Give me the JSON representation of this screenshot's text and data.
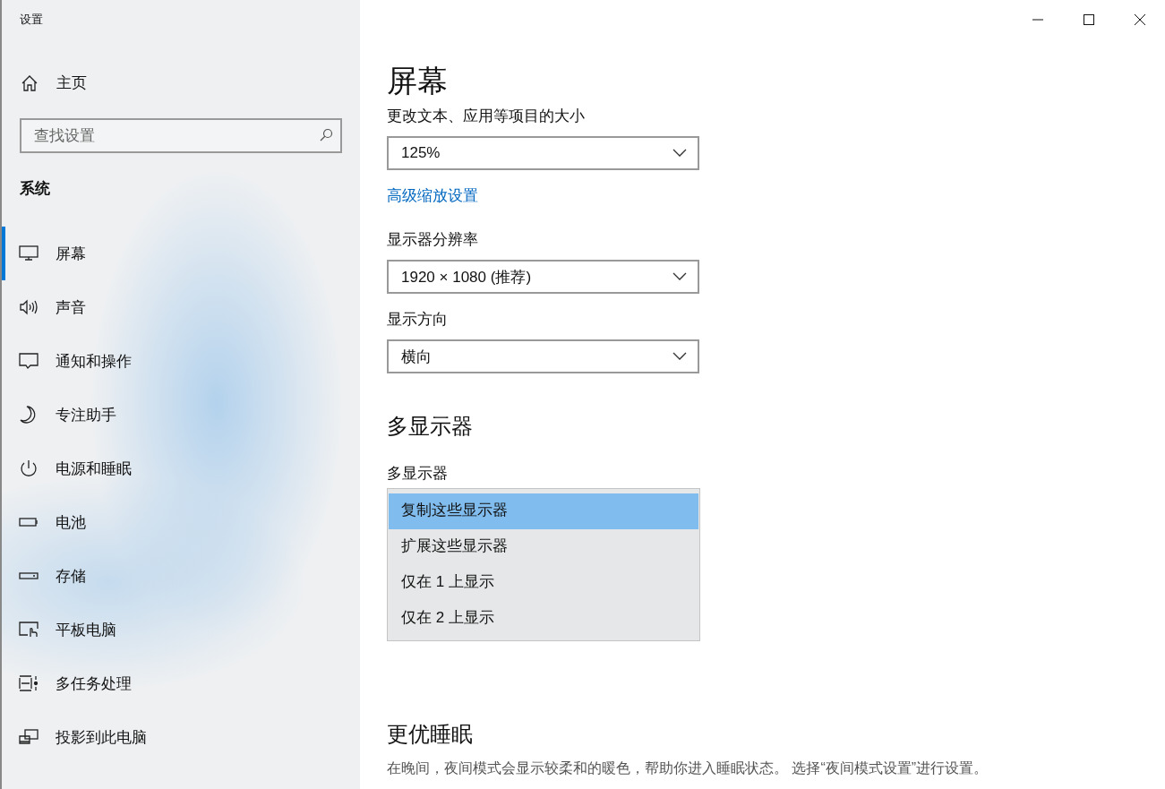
{
  "window": {
    "title": "设置"
  },
  "sidebar": {
    "home": "主页",
    "search": {
      "placeholder": "查找设置"
    },
    "section": "系统",
    "items": [
      {
        "label": "屏幕",
        "selected": true
      },
      {
        "label": "声音",
        "selected": false
      },
      {
        "label": "通知和操作",
        "selected": false
      },
      {
        "label": "专注助手",
        "selected": false
      },
      {
        "label": "电源和睡眠",
        "selected": false
      },
      {
        "label": "电池",
        "selected": false
      },
      {
        "label": "存储",
        "selected": false
      },
      {
        "label": "平板电脑",
        "selected": false
      },
      {
        "label": "多任务处理",
        "selected": false
      },
      {
        "label": "投影到此电脑",
        "selected": false
      }
    ]
  },
  "main": {
    "title": "屏幕",
    "scale": {
      "label": "更改文本、应用等项目的大小",
      "value": "125%"
    },
    "advanced_link": "高级缩放设置",
    "resolution": {
      "label": "显示器分辨率",
      "value": "1920 × 1080 (推荐)"
    },
    "orientation": {
      "label": "显示方向",
      "value": "横向"
    },
    "multi_heading": "多显示器",
    "multi_display": {
      "label": "多显示器",
      "options": [
        {
          "label": "复制这些显示器",
          "selected": true
        },
        {
          "label": "扩展这些显示器",
          "selected": false
        },
        {
          "label": "仅在 1 上显示",
          "selected": false
        },
        {
          "label": "仅在 2 上显示",
          "selected": false
        }
      ]
    },
    "sleep_heading": "更优睡眠",
    "sleep_text": "在晚间，夜间模式会显示较柔和的暖色，帮助你进入睡眠状态。 选择“夜间模式设置”进行设置。"
  }
}
